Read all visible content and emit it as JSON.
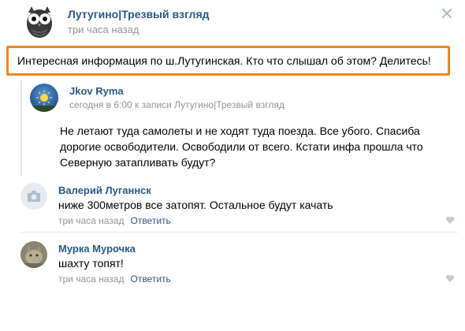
{
  "post": {
    "author": "Лутугино|Трезвый взгляд",
    "time": "три часа назад",
    "text": "Интересная информация по ш.Лутугинская. Кто что слышал об этом? Делитесь!"
  },
  "repost": {
    "author": "Jkov Ryma",
    "meta": "сегодня в 6:00 к записи Лутугино|Трезвый взгляд",
    "lines": [
      "Не летают туда самолеты и не ходят туда поезда. Все убого. Спасиба",
      "дорогие освободители. Освободили от всего. Кстати инфа прошла что",
      "Северную затапливать будут?"
    ]
  },
  "comments": [
    {
      "author": "Валерий Луганнск",
      "text": "ниже 300метров все затопят. Остальное будут качать",
      "time": "три часа назад",
      "reply": "Ответить"
    },
    {
      "author": "Мурка Мурочка",
      "text": "шахту топят!",
      "time": "три часа назад",
      "reply": "Ответить"
    }
  ],
  "icons": {
    "close": "close-icon",
    "like": "heart-icon",
    "camera": "camera-icon"
  },
  "colors": {
    "link": "#2a5885",
    "muted": "#939393",
    "highlight_border": "#f0861e"
  }
}
